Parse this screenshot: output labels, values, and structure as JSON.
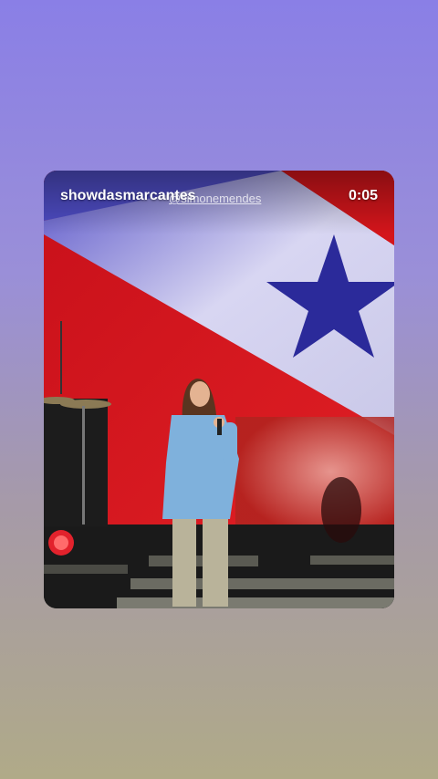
{
  "story": {
    "username": "showdasmarcantes",
    "watermark": "@simonemendes",
    "timer": "0:05"
  },
  "colors": {
    "background_top": "#8a7fe6",
    "background_bottom": "#b0aa88",
    "flag_red": "#d4151b",
    "flag_white": "#e9e9f6",
    "star_blue": "#2b2a9a"
  }
}
